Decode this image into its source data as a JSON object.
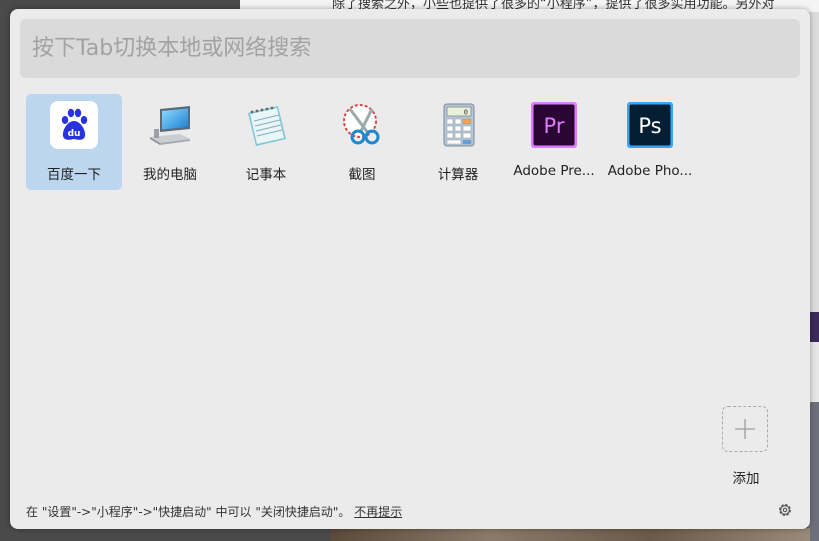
{
  "background": {
    "text_top": "除了搜索之外，小些也提供了很多的“小程序”，提供了很多实用功能。另外对"
  },
  "search": {
    "placeholder": "按下Tab切换本地或网络搜索",
    "value": ""
  },
  "apps": [
    {
      "label": "百度一下",
      "icon": "baidu-paw-icon",
      "selected": true
    },
    {
      "label": "我的电脑",
      "icon": "computer-icon",
      "selected": false
    },
    {
      "label": "记事本",
      "icon": "notepad-icon",
      "selected": false
    },
    {
      "label": "截图",
      "icon": "scissors-icon",
      "selected": false
    },
    {
      "label": "计算器",
      "icon": "calculator-icon",
      "selected": false
    },
    {
      "label": "Adobe Pre...",
      "icon": "premiere-icon",
      "selected": false
    },
    {
      "label": "Adobe Pho...",
      "icon": "photoshop-icon",
      "selected": false
    }
  ],
  "icon_text": {
    "baidu": "du",
    "calculator_display": "0",
    "premiere": "Pr",
    "photoshop": "Ps"
  },
  "add": {
    "label": "添加",
    "icon": "plus-icon"
  },
  "footer": {
    "text": "在 \"设置\"->\"小程序\"->\"快捷启动\" 中可以 \"关闭快捷启动\"。",
    "link": "不再提示",
    "settings_icon": "gear-icon"
  },
  "colors": {
    "selected_bg": "#bcd6ef",
    "premiere_bg": "#2a0634",
    "premiere_fg": "#e07bff",
    "photoshop_bg": "#061e33",
    "photoshop_fg": "#31a8ff",
    "baidu_blue": "#2932e1"
  }
}
